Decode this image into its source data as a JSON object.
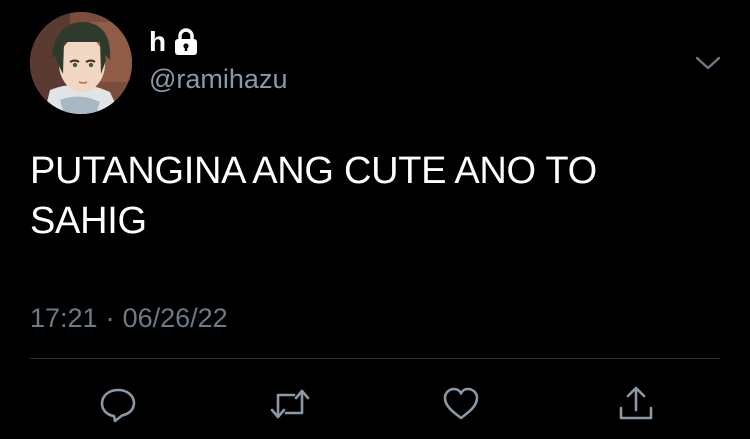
{
  "tweet": {
    "display_name": "h",
    "handle": "@ramihazu",
    "text": "PUTANGINA ANG CUTE ANO TO SAHIG",
    "time": "17:21",
    "separator": "·",
    "date": "06/26/22"
  },
  "icons": {
    "lock": "lock-icon",
    "menu": "chevron-down-icon",
    "reply": "reply-icon",
    "retweet": "retweet-icon",
    "like": "heart-icon",
    "share": "share-icon"
  },
  "colors": {
    "background": "#000000",
    "primary_text": "#ffffff",
    "secondary_text": "#8b98a5",
    "icon": "#8b98a5",
    "divider": "#2a2d31"
  }
}
